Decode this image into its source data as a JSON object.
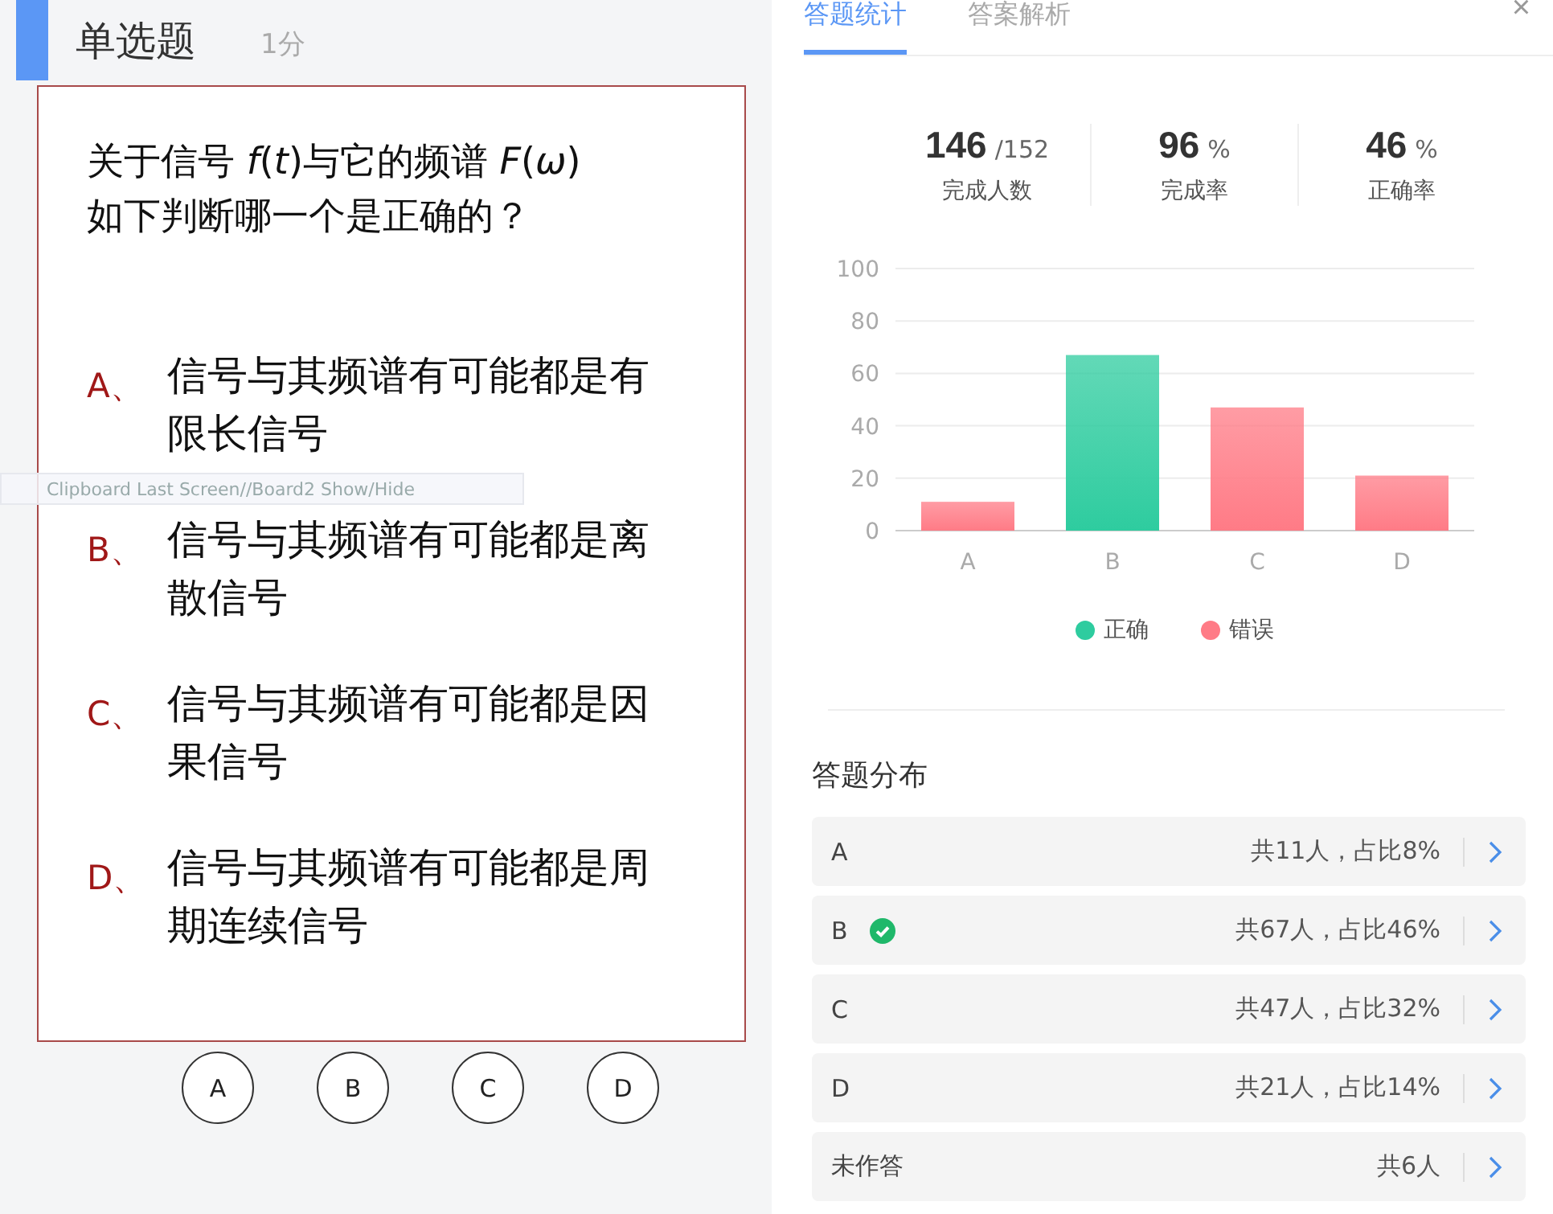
{
  "question": {
    "type": "单选题",
    "score": "1分",
    "stem": "关于信号 *f*(*t*)与它的频谱 *F*(*ω*)如下判断哪一个是正确的？",
    "options": [
      {
        "label": "A、",
        "text": "信号与其频谱有可能都是有限长信号"
      },
      {
        "label": "B、",
        "text": "信号与其频谱有可能都是离散信号"
      },
      {
        "label": "C、",
        "text": "信号与其频谱有可能都是因果信号"
      },
      {
        "label": "D、",
        "text": "信号与其频谱有可能都是周期连续信号"
      }
    ],
    "choices": [
      {
        "label": "A",
        "selected": false
      },
      {
        "label": "B",
        "selected": false
      },
      {
        "label": "C",
        "selected": false
      },
      {
        "label": "D",
        "selected": false
      }
    ]
  },
  "tooltip": "Clipboard Last Screen//Board2 Show/Hide",
  "tabs": [
    {
      "label": "答题统计",
      "selected": true
    },
    {
      "label": "答案解析",
      "selected": false
    }
  ],
  "close": "×",
  "stats": [
    {
      "value": "146",
      "unit": "/152",
      "label": "完成人数"
    },
    {
      "value": "96",
      "unit": "%",
      "label": "完成率"
    },
    {
      "value": "46",
      "unit": "%",
      "label": "正确率"
    }
  ],
  "chart_data": {
    "type": "bar",
    "categories": [
      "A",
      "B",
      "C",
      "D"
    ],
    "stacked": true,
    "grid": true,
    "legend": true,
    "ylim": [
      0,
      100
    ],
    "yticks": [
      0,
      20,
      40,
      60,
      80,
      100
    ],
    "series": [
      {
        "name": "正确",
        "color": "#2ecc9f",
        "values": [
          null,
          67,
          null,
          null
        ]
      },
      {
        "name": "错误",
        "color": "#ff7b86",
        "values": [
          11,
          null,
          47,
          21
        ]
      }
    ]
  },
  "distribution": {
    "title": "答题分布",
    "rows": [
      {
        "option": "A",
        "summary": "共11人，占比8%",
        "correct": false
      },
      {
        "option": "B",
        "summary": "共67人，占比46%",
        "correct": true
      },
      {
        "option": "C",
        "summary": "共47人，占比32%",
        "correct": false
      },
      {
        "option": "D",
        "summary": "共21人，占比14%",
        "correct": false
      },
      {
        "option": "未作答",
        "summary": "共6人",
        "correct": false
      }
    ]
  }
}
